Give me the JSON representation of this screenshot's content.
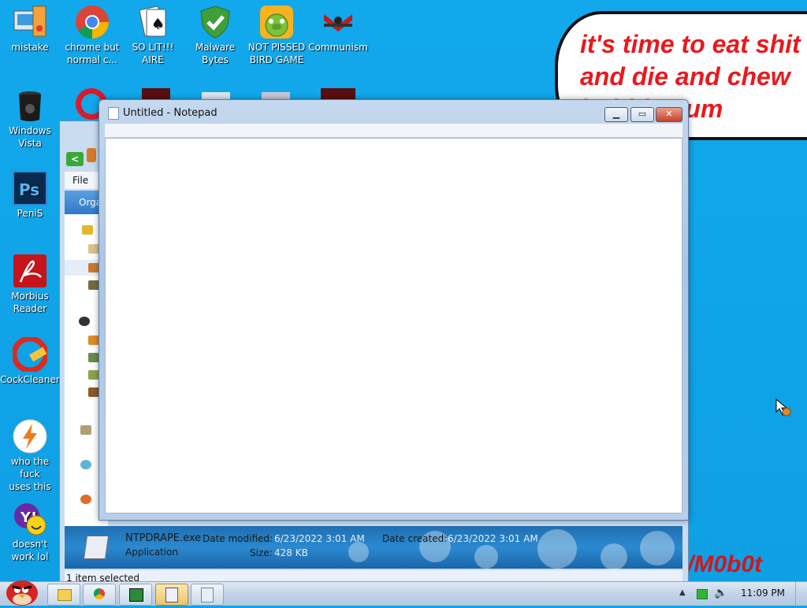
{
  "desktop_icons": [
    {
      "name": "mistake",
      "label": "mistake"
    },
    {
      "name": "chrome",
      "label": "chrome but\nnormal c..."
    },
    {
      "name": "solitaire",
      "label": "SO LIT!!!\nAIRE"
    },
    {
      "name": "malwarebytes",
      "label": "Malware\nBytes"
    },
    {
      "name": "pissed-bird",
      "label": "NOT PISSED\nBIRD GAME"
    },
    {
      "name": "communism",
      "label": "Communism"
    },
    {
      "name": "windows-vista",
      "label": "Windows\nVista"
    },
    {
      "name": "photoshop",
      "label": "PeniS"
    },
    {
      "name": "morbius-reader",
      "label": "Morbius\nReader"
    },
    {
      "name": "cockcleaner",
      "label": "CockCleaner"
    },
    {
      "name": "avast",
      "label": "who the fuck\nuses this"
    },
    {
      "name": "yahoo",
      "label": "doesn't\nwork lol"
    }
  ],
  "bubble_text": "it's time to eat shit\nand die and chew\nbubble gum",
  "graffiti_text": "/M0b0t",
  "explorer": {
    "menu_file": "File",
    "organize": "Orga",
    "details": {
      "filename": "NTPDRAPE.exe",
      "type": "Application",
      "date_modified_label": "Date modified:",
      "date_modified": "6/23/2022 3:01 AM",
      "date_created_label": "Date created:",
      "date_created": "6/23/2022 3:01 AM",
      "size_label": "Size:",
      "size": "428 KB"
    },
    "status": "1 item selected"
  },
  "notepad": {
    "title": "Untitled - Notepad",
    "content": ""
  },
  "taskbar": {
    "clock": "11:09 PM"
  }
}
